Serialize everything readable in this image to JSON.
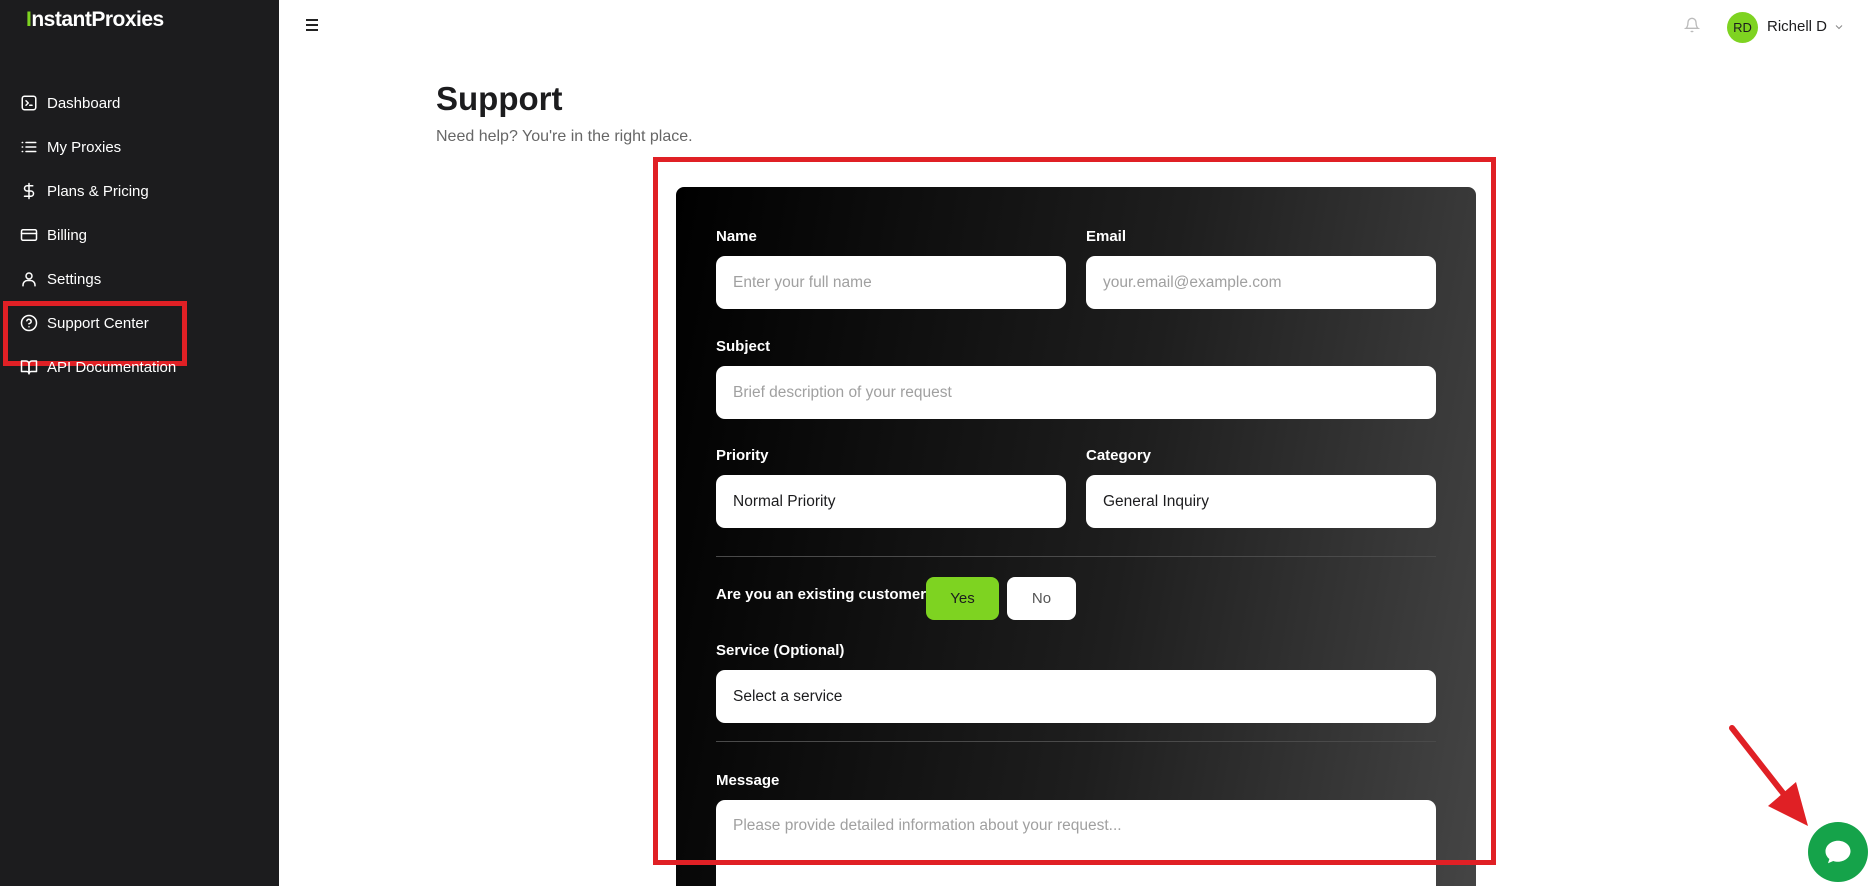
{
  "brand": {
    "logo_prefix": "I",
    "logo_mid": "nstant",
    "logo_rest": "Proxies"
  },
  "sidebar": {
    "items": [
      {
        "label": "Dashboard",
        "icon": "terminal-icon"
      },
      {
        "label": "My Proxies",
        "icon": "list-icon"
      },
      {
        "label": "Plans & Pricing",
        "icon": "dollar-icon"
      },
      {
        "label": "Billing",
        "icon": "credit-card-icon"
      },
      {
        "label": "Settings",
        "icon": "user-icon"
      },
      {
        "label": "Support Center",
        "icon": "help-circle-icon",
        "active": true
      },
      {
        "label": "API Documentation",
        "icon": "book-icon"
      }
    ]
  },
  "topbar": {
    "avatar_initials": "RD",
    "user_name": "Richell D"
  },
  "page": {
    "title": "Support",
    "subtitle": "Need help? You're in the right place."
  },
  "form": {
    "name": {
      "label": "Name",
      "placeholder": "Enter your full name"
    },
    "email": {
      "label": "Email",
      "placeholder": "your.email@example.com"
    },
    "subject": {
      "label": "Subject",
      "placeholder": "Brief description of your request"
    },
    "priority": {
      "label": "Priority",
      "value": "Normal Priority"
    },
    "category": {
      "label": "Category",
      "value": "General Inquiry"
    },
    "existing_customer": {
      "question": "Are you an existing customer?",
      "yes": "Yes",
      "no": "No",
      "selected": "Yes"
    },
    "service": {
      "label": "Service (Optional)",
      "value": "Select a service"
    },
    "message": {
      "label": "Message",
      "placeholder": "Please provide detailed information about your request..."
    }
  },
  "colors": {
    "accent": "#7ed321",
    "sidebar_bg": "#1c1c1e",
    "highlight": "#e02025",
    "chat": "#15a34a"
  }
}
